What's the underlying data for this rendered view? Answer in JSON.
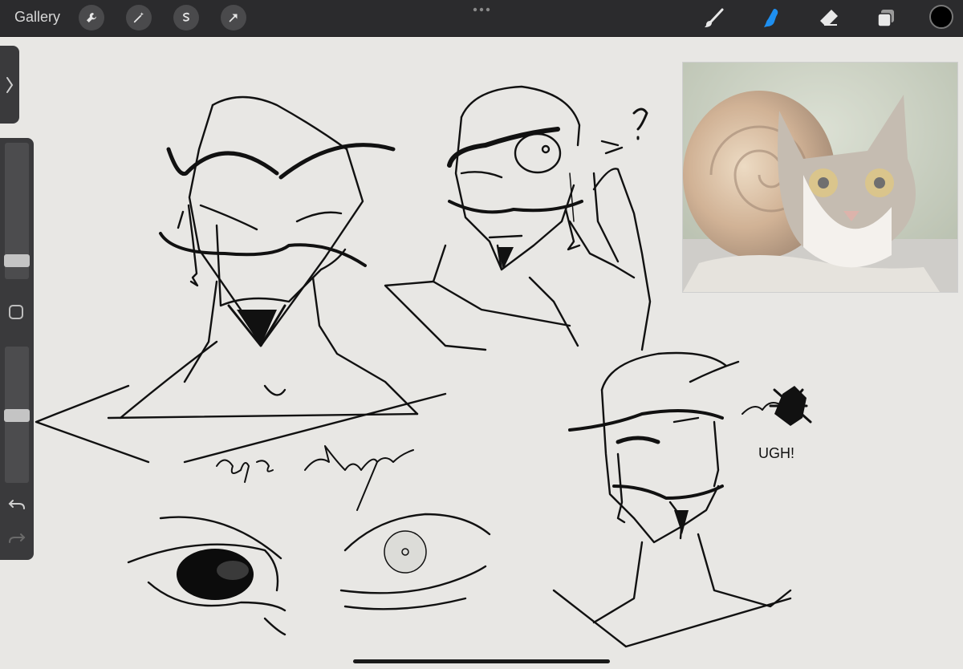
{
  "toolbar": {
    "gallery_label": "Gallery",
    "icons": [
      "wrench-icon",
      "magic-wand-icon",
      "selection-icon",
      "transform-arrow-icon"
    ],
    "right_tools": [
      "brush-icon",
      "smudge-icon",
      "eraser-icon",
      "layers-icon"
    ],
    "active_tool": "smudge-icon",
    "active_color": "#000000",
    "accent_color": "#1e8ff0"
  },
  "canvas": {
    "sketch_labels": {
      "handwriting_1": "eye closing",
      "exclaim": "UGH!",
      "question": "?"
    }
  },
  "sidebar": {
    "size_slider_level": 0.88,
    "opacity_slider_level": 0.51
  }
}
